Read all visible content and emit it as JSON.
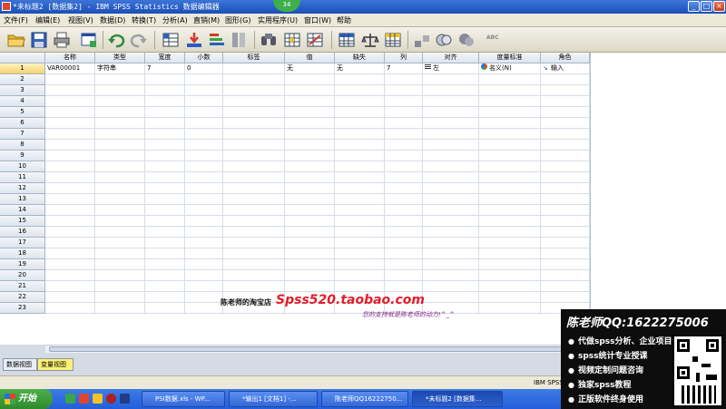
{
  "window": {
    "title": "*未标题2 [数据集2] - IBM SPSS Statistics 数据编辑器",
    "badge": "34",
    "min_label": "_",
    "max_label": "□",
    "close_label": "×"
  },
  "menu": [
    {
      "label": "文件(F)"
    },
    {
      "label": "编辑(E)"
    },
    {
      "label": "视图(V)"
    },
    {
      "label": "数据(D)"
    },
    {
      "label": "转换(T)"
    },
    {
      "label": "分析(A)"
    },
    {
      "label": "直销(M)"
    },
    {
      "label": "图形(G)"
    },
    {
      "label": "实用程序(U)"
    },
    {
      "label": "窗口(W)"
    },
    {
      "label": "帮助"
    }
  ],
  "toolbar": {
    "icons": [
      "open-folder-icon",
      "save-icon",
      "print-icon",
      "dialog-recall-icon",
      "undo-icon",
      "redo-icon",
      "goto-case-icon",
      "goto-variable-icon",
      "variables-icon",
      "insert-cases-icon",
      "find-icon",
      "insert-variable-icon",
      "split-file-icon",
      "data-table-icon",
      "weight-cases-icon",
      "select-cases-icon",
      "value-labels-icon",
      "use-sets-icon",
      "show-sets-icon",
      "spell-icon"
    ],
    "spell_label": "ABC"
  },
  "grid": {
    "columns": [
      "名称",
      "类型",
      "宽度",
      "小数",
      "标签",
      "值",
      "缺失",
      "列",
      "对齐",
      "度量标准",
      "角色"
    ],
    "rows": [
      {
        "num": "1",
        "cells": [
          "VAR00001",
          "字符串",
          "7",
          "0",
          "",
          "无",
          "无",
          "7",
          "左",
          "名义(N)",
          "输入"
        ]
      },
      {
        "num": "2"
      },
      {
        "num": "3"
      },
      {
        "num": "4"
      },
      {
        "num": "5"
      },
      {
        "num": "6"
      },
      {
        "num": "7"
      },
      {
        "num": "8"
      },
      {
        "num": "9"
      },
      {
        "num": "10"
      },
      {
        "num": "11"
      },
      {
        "num": "12"
      },
      {
        "num": "13"
      },
      {
        "num": "14"
      },
      {
        "num": "15"
      },
      {
        "num": "16"
      },
      {
        "num": "17"
      },
      {
        "num": "18"
      },
      {
        "num": "19"
      },
      {
        "num": "20"
      },
      {
        "num": "21"
      },
      {
        "num": "22"
      },
      {
        "num": "23"
      }
    ]
  },
  "tabs": {
    "data_view": "数据视图",
    "variable_view": "变量视图"
  },
  "status": {
    "text": "IBM SPSS"
  },
  "watermark": {
    "shop": "陈老师的淘宝店",
    "url": "Spss520.taobao.com",
    "support": "您的支持就是陈老师的动力!^_^"
  },
  "ad": {
    "header": "陈老师QQ:1622275006",
    "lines": [
      "代做spss分析、企业项目合作",
      "spss统计专业授课",
      "视频定制问题咨询",
      "独家spss教程",
      "正版软件终身使用"
    ]
  },
  "taskbar": {
    "start": "开始",
    "tasks": [
      {
        "label": "PSI数据.xls - WP..."
      },
      {
        "label": "*输出1 [文档1] -..."
      },
      {
        "label": "陈老师QQ16222750..."
      },
      {
        "label": "*未标题2 [数据集..."
      }
    ]
  },
  "colors": {
    "title_bar": "#245edb",
    "active_tab": "#fff176",
    "watermark_url": "#e11d2a",
    "ad_background": "#0d0d0d"
  }
}
